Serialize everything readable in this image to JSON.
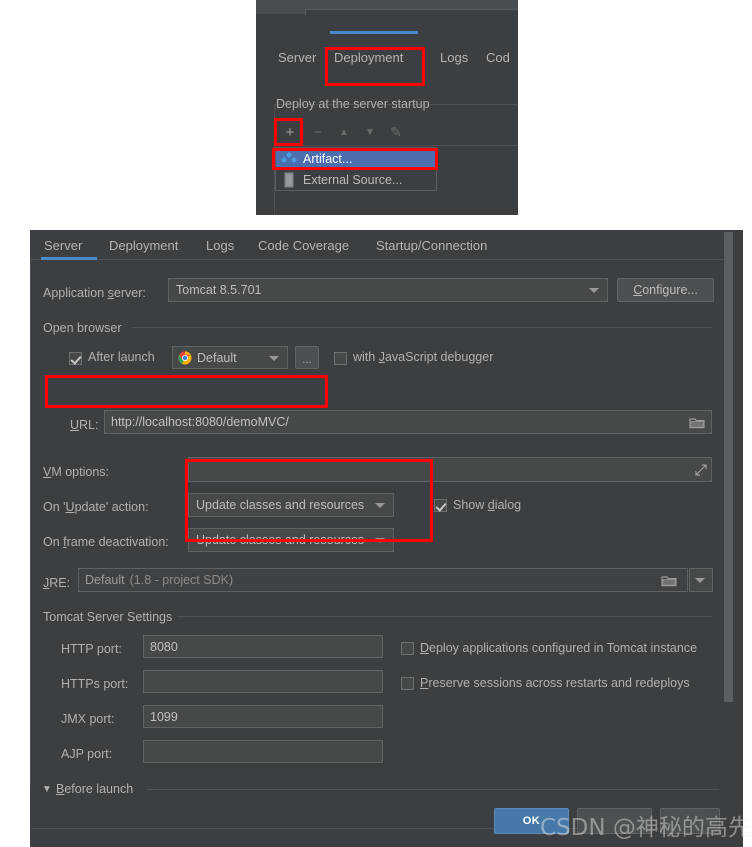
{
  "top_panel": {
    "tabs": [
      {
        "label": "Server",
        "active": false
      },
      {
        "label": "Deployment",
        "active": true
      },
      {
        "label": "Logs",
        "active": false
      },
      {
        "label": "Cod",
        "active": false
      }
    ],
    "group_label": "Deploy at the server startup",
    "toolbar": [
      {
        "name": "add-icon",
        "glyph": "+",
        "enabled": true
      },
      {
        "name": "remove-icon",
        "glyph": "−",
        "enabled": false
      },
      {
        "name": "move-up-icon",
        "glyph": "▲",
        "enabled": false
      },
      {
        "name": "move-down-icon",
        "glyph": "▼",
        "enabled": false
      },
      {
        "name": "edit-pencil-icon",
        "glyph": "✎",
        "enabled": false
      }
    ],
    "popup_menu": [
      {
        "label": "Artifact...",
        "icon": "artifact-icon",
        "selected": true
      },
      {
        "label": "External Source...",
        "icon": "external-source-icon",
        "selected": false
      }
    ]
  },
  "dialog": {
    "tabs": [
      {
        "label": "Server",
        "active": true
      },
      {
        "label": "Deployment",
        "active": false
      },
      {
        "label": "Logs",
        "active": false
      },
      {
        "label": "Code Coverage",
        "active": false
      },
      {
        "label": "Startup/Connection",
        "active": false
      }
    ],
    "application_server": {
      "label_pre": "Application ",
      "label_u": "s",
      "label_post": "erver:",
      "value": "Tomcat 8.5.701",
      "configure_button": {
        "pre": "",
        "u": "C",
        "post": "onfigure..."
      }
    },
    "open_browser": {
      "group_label": "Open browser",
      "after_launch": {
        "label": "After launch",
        "checked": true
      },
      "browser": {
        "value": "Default",
        "icon": "chrome-icon"
      },
      "browse_button": "...",
      "js_debugger": {
        "pre": "with ",
        "u": "J",
        "post": "avaScript debugger",
        "checked": false
      },
      "url": {
        "label_u": "U",
        "label_post": "RL:",
        "value": "http://localhost:8080/demoMVC/",
        "folder_icon": "folder-icon"
      }
    },
    "vm_options": {
      "label_u": "V",
      "label_post": "M options:",
      "value": "",
      "expand_icon": "expand-icon"
    },
    "on_update_action": {
      "label_pre": "On '",
      "label_u": "U",
      "label_post": "pdate' action:",
      "value": "Update classes and resources",
      "show_dialog": {
        "pre": "Show ",
        "u": "d",
        "post": "ialog",
        "checked": true
      }
    },
    "on_frame_deactivation": {
      "label_pre": "On ",
      "label_u": "f",
      "label_post": "rame deactivation:",
      "value": "Update classes and resources"
    },
    "jre": {
      "label_u": "J",
      "label_post": "RE:",
      "value": "Default",
      "value_hint": "(1.8 - project SDK)",
      "folder_icon": "folder-icon",
      "dropdown_icon": "chevron-down-icon"
    },
    "tomcat_server_settings": {
      "group_label": "Tomcat Server Settings",
      "ports": [
        {
          "label": "HTTP port:",
          "value": "8080"
        },
        {
          "label": "HTTPs port:",
          "value": ""
        },
        {
          "label": "JMX port:",
          "value": "1099"
        },
        {
          "label": "AJP port:",
          "value": ""
        }
      ],
      "checkboxes": [
        {
          "pre": "",
          "u": "D",
          "post": "eploy applications configured in Tomcat instance",
          "checked": false
        },
        {
          "pre": "",
          "u": "P",
          "post": "reserve sessions across restarts and redeploys",
          "checked": false
        }
      ]
    },
    "before_launch": {
      "arrow": "▼",
      "label_u": "B",
      "label_post": "efore launch"
    },
    "buttons": [
      {
        "label": "OK",
        "primary": true
      },
      {
        "label": "",
        "primary": false
      },
      {
        "label": "",
        "primary": false
      }
    ]
  },
  "watermark": {
    "text": "CSDN @神秘的高先生"
  },
  "colors": {
    "panel_bg": "#3c3f41",
    "accent_blue": "#4a88c7",
    "selection_blue": "#4b6eaf",
    "annotation_red": "#fe0000",
    "field_bg": "#45494a"
  }
}
